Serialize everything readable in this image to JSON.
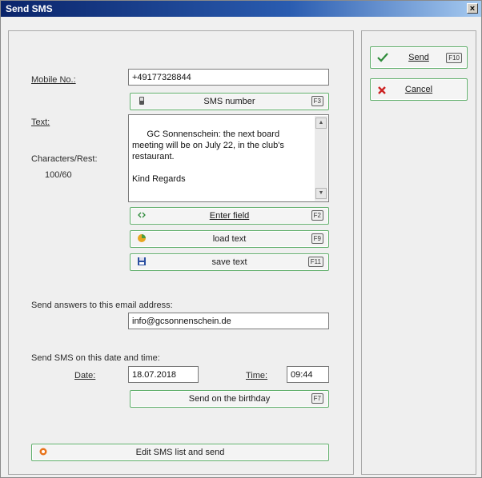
{
  "window": {
    "title": "Send SMS",
    "close_glyph": "×"
  },
  "labels": {
    "mobile_no": "Mobile No.:",
    "text": "Text:",
    "chars_rest": "Characters/Rest:",
    "chars_value": "100/60",
    "email_section": "Send answers to this email address:",
    "datetime_section": "Send SMS on this date and time:",
    "date": "Date:",
    "time": "Time:"
  },
  "fields": {
    "mobile": "+49177328844",
    "message": "GC Sonnenschein: the next board meeting will be on July 22, in the club's restaurant.\n\nKind Regards",
    "email": "info@gcsonnenschein.de",
    "date": "18.07.2018",
    "time": "09:44"
  },
  "buttons": {
    "sms_number": {
      "label": "SMS number",
      "key": "F3",
      "icon": "phone-icon"
    },
    "enter_field": {
      "label": "Enter field",
      "key": "F2",
      "icon": "field-icon"
    },
    "load_text": {
      "label": "load text",
      "key": "F9",
      "icon": "folder-icon"
    },
    "save_text": {
      "label": "save text",
      "key": "F11",
      "icon": "floppy-icon"
    },
    "birthday": {
      "label": "Send on the birthday",
      "key": "F7"
    },
    "edit_list": {
      "label": "Edit SMS list and send",
      "icon": "ring-icon"
    },
    "send": {
      "label": "Send",
      "key": "F10",
      "icon": "check-icon"
    },
    "cancel": {
      "label": "Cancel",
      "icon": "x-icon"
    }
  },
  "colors": {
    "button_border": "#5fae6a",
    "title_bar": "#0a246a",
    "check": "#2e8b3a",
    "cancel": "#cc2222"
  }
}
